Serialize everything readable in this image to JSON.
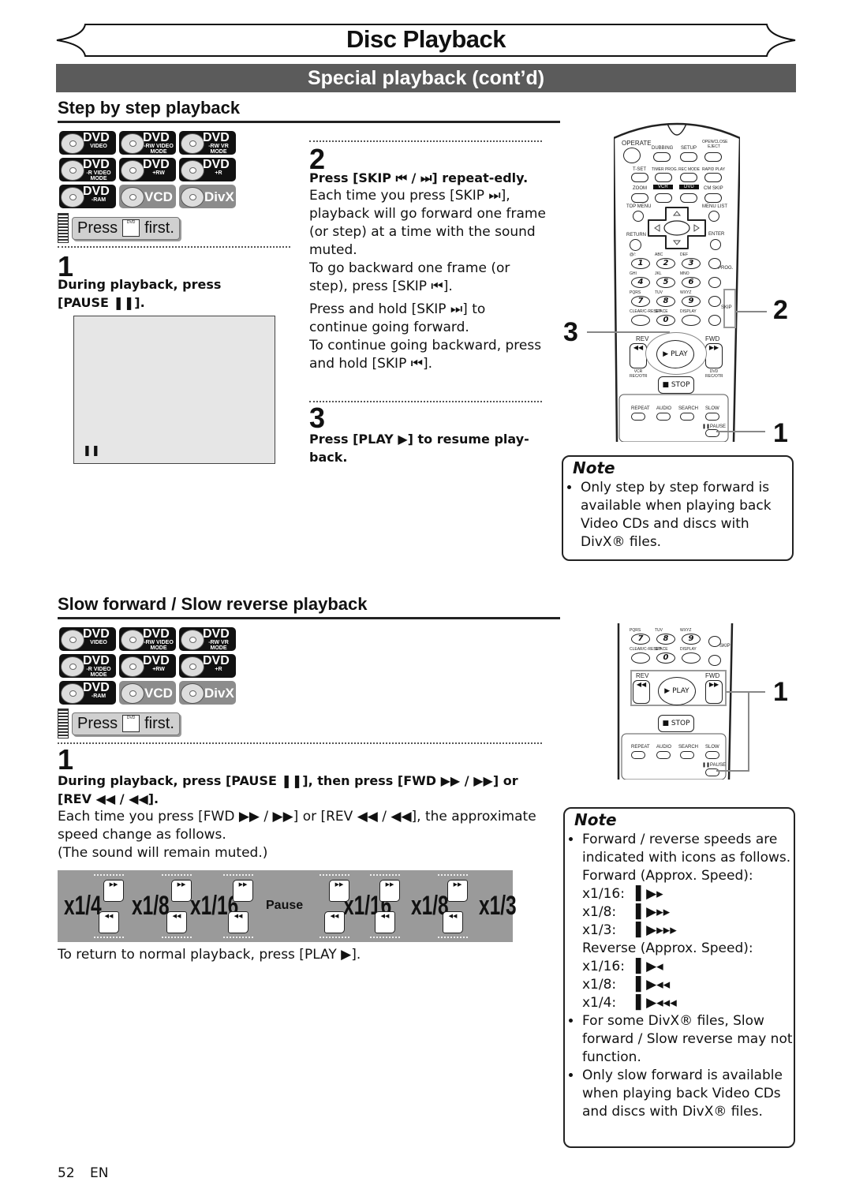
{
  "header": {
    "title": "Disc Playback",
    "subtitle": "Special playback (cont’d)"
  },
  "disc_badges": [
    {
      "label": "DVD",
      "sub": "VIDEO",
      "style": "black"
    },
    {
      "label": "DVD",
      "sub": "-RW VIDEO MODE",
      "style": "black"
    },
    {
      "label": "DVD",
      "sub": "-RW VR MODE",
      "style": "black"
    },
    {
      "label": "DVD",
      "sub": "-R VIDEO MODE",
      "style": "black"
    },
    {
      "label": "DVD",
      "sub": "+RW",
      "style": "black"
    },
    {
      "label": "DVD",
      "sub": "+R",
      "style": "black"
    },
    {
      "label": "DVD",
      "sub": "-RAM",
      "style": "black"
    },
    {
      "label": "VCD",
      "sub": "",
      "style": "grey"
    },
    {
      "label": "DivX",
      "sub": "",
      "style": "grey"
    }
  ],
  "press_first": {
    "press": "Press",
    "key": "DVD",
    "first": "first."
  },
  "step_section": {
    "title": "Step by step playback",
    "step1": {
      "num": "1",
      "instruction": "During playback, press [PAUSE ❚❚].",
      "screen_indicator": "❚❚"
    },
    "step2": {
      "num": "2",
      "instruction": "Press [SKIP ⏮ / ⏭] repeat-edly.",
      "p1": "Each time you press [SKIP ⏭], playback will go forward one frame (or step) at a time with the sound muted.",
      "p2": "To go backward one frame (or step), press [SKIP ⏮].",
      "p3": "Press and hold [SKIP ⏭] to continue going forward.",
      "p4": "To continue going backward, press and hold [SKIP ⏮]."
    },
    "step3": {
      "num": "3",
      "instruction": "Press [PLAY ▶] to resume play-back."
    },
    "callouts": [
      "2",
      "3",
      "1"
    ],
    "note": {
      "title": "Note",
      "items": [
        "Only step by step forward is available when playing back Video CDs and discs with DivX® files."
      ]
    }
  },
  "remote": {
    "operate": "OPERATE",
    "dubbing": "DUBBING",
    "setup": "SETUP",
    "open_close": "OPEN/CLOSE EJECT",
    "tset": "T-SET",
    "timer_prog": "TIMER PROG.",
    "rec_mode": "REC MODE",
    "rapid_play": "RAPID PLAY",
    "zoom": "ZOOM",
    "vcr": "VCR",
    "dvd": "DVD",
    "cm_skip": "CM SKIP",
    "top_menu": "TOP MENU",
    "menu_list": "MENU LIST",
    "return": "RETURN",
    "enter": "ENTER",
    "keys": [
      {
        "letters": "@/:",
        "num": "1"
      },
      {
        "letters": "ABC",
        "num": "2"
      },
      {
        "letters": "DEF",
        "num": "3"
      },
      {
        "letters": "GHI",
        "num": "4"
      },
      {
        "letters": "JKL",
        "num": "5"
      },
      {
        "letters": "MNO",
        "num": "6"
      },
      {
        "letters": "PQRS",
        "num": "7"
      },
      {
        "letters": "TUV",
        "num": "8"
      },
      {
        "letters": "WXYZ",
        "num": "9"
      },
      {
        "letters": "CLEAR/C-RESET",
        "num": ""
      },
      {
        "letters": "SPACE",
        "num": "0"
      },
      {
        "letters": "DISPLAY",
        "num": ""
      }
    ],
    "prog": "PROG.",
    "skip": "SKIP",
    "rev": "REV",
    "fwd": "FWD",
    "play": "▶ PLAY",
    "stop": "■ STOP",
    "vcr_rec": "VCR REC/OTR",
    "dvd_rec": "DVD REC/OTR",
    "repeat": "REPEAT",
    "audio": "AUDIO",
    "search": "SEARCH",
    "slow": "SLOW",
    "pause": "❚❚PAUSE"
  },
  "slow_section": {
    "title": "Slow forward / Slow reverse playback",
    "step1": {
      "num": "1",
      "instruction": "During playback, press [PAUSE ❚❚], then press [FWD ▶▶ / ▶▶] or [REV ◀◀ / ◀◀].",
      "p1": "Each time you press [FWD ▶▶ / ▶▶] or [REV ◀◀ / ◀◀], the approximate speed change as follows.",
      "p2": "(The sound will remain muted.)"
    },
    "speeds": [
      "x1/4",
      "x1/8",
      "x1/16",
      "Pause",
      "x1/16",
      "x1/8",
      "x1/3"
    ],
    "return_text": "To return to normal playback, press [PLAY ▶].",
    "callout": "1",
    "note": {
      "title": "Note",
      "item1": "Forward / reverse speeds are indicated with icons as follows.",
      "forward_label": "Forward (Approx. Speed):",
      "forward": [
        {
          "speed": "x1/16:",
          "icon": "▌▶▸"
        },
        {
          "speed": "x1/8:",
          "icon": "▌▶▸▸"
        },
        {
          "speed": "x1/3:",
          "icon": "▌▶▸▸▸"
        }
      ],
      "reverse_label": "Reverse (Approx. Speed):",
      "reverse": [
        {
          "speed": "x1/16:",
          "icon": "▌▶◂"
        },
        {
          "speed": "x1/8:",
          "icon": "▌▶◂◂"
        },
        {
          "speed": "x1/4:",
          "icon": "▌▶◂◂◂"
        }
      ],
      "item2": "For some DivX® files, Slow forward / Slow reverse may not function.",
      "item3": "Only slow forward is available when playing back Video CDs and discs with DivX® files."
    }
  },
  "footer": {
    "page": "52",
    "lang": "EN"
  }
}
